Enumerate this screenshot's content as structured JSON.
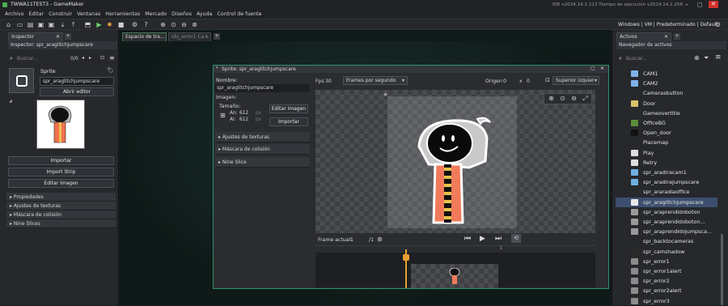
{
  "window": {
    "title": "TWWA11TEST3 - GameMaker",
    "ide_info": "IDE v2024.14.2.213  Tiempo de ejecución v2024.14.2.256"
  },
  "menu": [
    "Archivo",
    "Editar",
    "Construir",
    "Ventanas",
    "Herramientas",
    "Mercado",
    "Diseños",
    "Ayuda",
    "Control de fuente"
  ],
  "targets": "Windows | VM | Predeterminado | Default",
  "inspector": {
    "tab": "Inspector",
    "title": "Inspector: spr_araglitchjumpscare",
    "search_placeholder": "Buscar...",
    "count": "0/0",
    "type": "Sprite",
    "name": "spr_araglitchjumpscare",
    "open_editor": "Abrir editor",
    "import": "Importar",
    "import_strip": "Import Strip",
    "edit_image": "Editar imagen",
    "sections": [
      "Propiedades",
      "Ajustes de texturas",
      "Máscara de colisión",
      "Nine Slices"
    ]
  },
  "workspace": {
    "tab1": "Espacio de tra...",
    "tab2": "obj_error1 Ca..."
  },
  "sprite_editor": {
    "title": "Sprite: spr_araglitchjumpscare",
    "name_label": "Nombre:",
    "name": "spr_araglitchjumpscare",
    "image_label": "Imagen:",
    "size_label": "Tamaño:",
    "width_label": "An:",
    "width": "612",
    "height_label": "Al:",
    "height": "612",
    "px": "px",
    "edit_image": "Editar imagen",
    "import": "Importar",
    "sections": [
      "Ajustes de texturas",
      "Máscara de colisión",
      "Nine Slice"
    ],
    "fps_label": "Fps",
    "fps": "30",
    "fps_mode": "Frames por segundo",
    "origin_label": "Origen",
    "origin_x": "0",
    "origin_sep": "x",
    "origin_y": "0",
    "origin_preset": "Superior izquier",
    "frame_label": "Frame actual:",
    "frame": "1",
    "frame_total": "/1",
    "timeline_mark": "1"
  },
  "assets": {
    "tab": "Activos",
    "navigator": "Navegador de activos",
    "search_placeholder": "Buscar...",
    "items": [
      {
        "name": "CAM1",
        "color": "#7fb3e8"
      },
      {
        "name": "CAM2",
        "color": "#7fb3e8"
      },
      {
        "name": "Camerasbutton",
        "color": ""
      },
      {
        "name": "Door",
        "color": "#d8c26a"
      },
      {
        "name": "Gameovertitle",
        "color": ""
      },
      {
        "name": "OfficeBG",
        "color": "#5c8f3c"
      },
      {
        "name": "Open_door",
        "color": "#111111"
      },
      {
        "name": "Placemap",
        "color": ""
      },
      {
        "name": "Play",
        "color": "#dddddd"
      },
      {
        "name": "Retry",
        "color": "#dddddd"
      },
      {
        "name": "spr_aradiracam1",
        "color": "#6db0e0"
      },
      {
        "name": "spr_aradirajumpscare",
        "color": "#6db0e0"
      },
      {
        "name": "spr_araradiaoffice",
        "color": ""
      },
      {
        "name": "spr_araglitchjumpscare",
        "color": "#e8e8e8"
      },
      {
        "name": "spr_araprendidoboton",
        "color": "#9a9a9a"
      },
      {
        "name": "spr_araprendidoboton...",
        "color": "#9a9a9a"
      },
      {
        "name": "spr_araprendidojumpsca...",
        "color": "#9a9a9a"
      },
      {
        "name": "spr_backtocameras",
        "color": ""
      },
      {
        "name": "spr_camshadow",
        "color": "#2a2a2a"
      },
      {
        "name": "spr_error1",
        "color": "#8c8c8c"
      },
      {
        "name": "spr_error1alert",
        "color": "#8c8c8c"
      },
      {
        "name": "spr_error2",
        "color": "#8c8c8c"
      },
      {
        "name": "spr_error2alert",
        "color": "#8c8c8c"
      },
      {
        "name": "spr_error3",
        "color": "#8c8c8c"
      }
    ]
  }
}
